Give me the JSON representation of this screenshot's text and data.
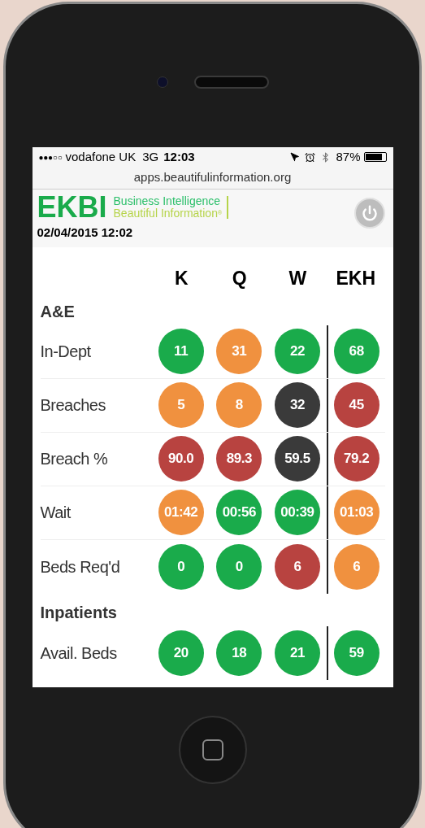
{
  "status_bar": {
    "signal": "●●●○○",
    "carrier": "vodafone UK",
    "network": "3G",
    "time": "12:03",
    "battery": {
      "text": "87%",
      "level": 0.87
    }
  },
  "url": "apps.beautifulinformation.org",
  "header": {
    "logo": "EKBI",
    "tagline_1": "Business Intelligence",
    "tagline_2": "Beautiful Information",
    "tagline_mark": "®",
    "timestamp": "02/04/2015 12:02"
  },
  "columns": [
    "K",
    "Q",
    "W",
    "EKH"
  ],
  "sections": [
    {
      "title": "A&E",
      "rows": [
        {
          "label": "In-Dept",
          "cells": [
            {
              "value": "11",
              "color": "#1aab4b"
            },
            {
              "value": "31",
              "color": "#f0913f"
            },
            {
              "value": "22",
              "color": "#1aab4b"
            },
            {
              "value": "68",
              "color": "#1aab4b"
            }
          ]
        },
        {
          "label": "Breaches",
          "cells": [
            {
              "value": "5",
              "color": "#f0913f"
            },
            {
              "value": "8",
              "color": "#f0913f"
            },
            {
              "value": "32",
              "color": "#3a3a3a"
            },
            {
              "value": "45",
              "color": "#b84340"
            }
          ]
        },
        {
          "label": "Breach %",
          "cells": [
            {
              "value": "90.0",
              "color": "#b84340"
            },
            {
              "value": "89.3",
              "color": "#b84340"
            },
            {
              "value": "59.5",
              "color": "#3a3a3a"
            },
            {
              "value": "79.2",
              "color": "#b84340"
            }
          ]
        },
        {
          "label": "Wait",
          "cells": [
            {
              "value": "01:42",
              "color": "#f0913f"
            },
            {
              "value": "00:56",
              "color": "#1aab4b"
            },
            {
              "value": "00:39",
              "color": "#1aab4b"
            },
            {
              "value": "01:03",
              "color": "#f0913f"
            }
          ]
        },
        {
          "label": "Beds Req'd",
          "cells": [
            {
              "value": "0",
              "color": "#1aab4b"
            },
            {
              "value": "0",
              "color": "#1aab4b"
            },
            {
              "value": "6",
              "color": "#b84340"
            },
            {
              "value": "6",
              "color": "#f0913f"
            }
          ]
        }
      ]
    },
    {
      "title": "Inpatients",
      "rows": [
        {
          "label": "Avail. Beds",
          "cells": [
            {
              "value": "20",
              "color": "#1aab4b"
            },
            {
              "value": "18",
              "color": "#1aab4b"
            },
            {
              "value": "21",
              "color": "#1aab4b"
            },
            {
              "value": "59",
              "color": "#1aab4b"
            }
          ]
        }
      ]
    }
  ]
}
